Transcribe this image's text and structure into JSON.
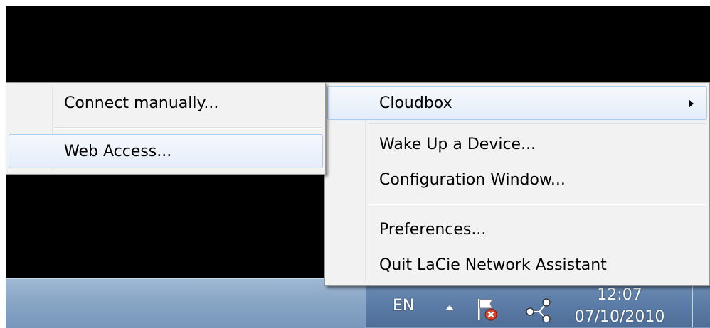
{
  "submenu": {
    "items": [
      {
        "label": "Connect manually..."
      },
      {
        "label": "Web Access..."
      }
    ]
  },
  "main_menu": {
    "items": [
      {
        "label": "Cloudbox"
      },
      {
        "label": "Wake Up a Device..."
      },
      {
        "label": "Configuration Window..."
      },
      {
        "label": "Preferences..."
      },
      {
        "label": "Quit LaCie Network Assistant"
      }
    ]
  },
  "taskbar": {
    "language": "EN",
    "time": "12:07",
    "date": "07/10/2010",
    "icons": [
      "show-hidden-icons-arrow-icon",
      "action-center-flag-icon",
      "lacie-network-assistant-icon"
    ]
  }
}
